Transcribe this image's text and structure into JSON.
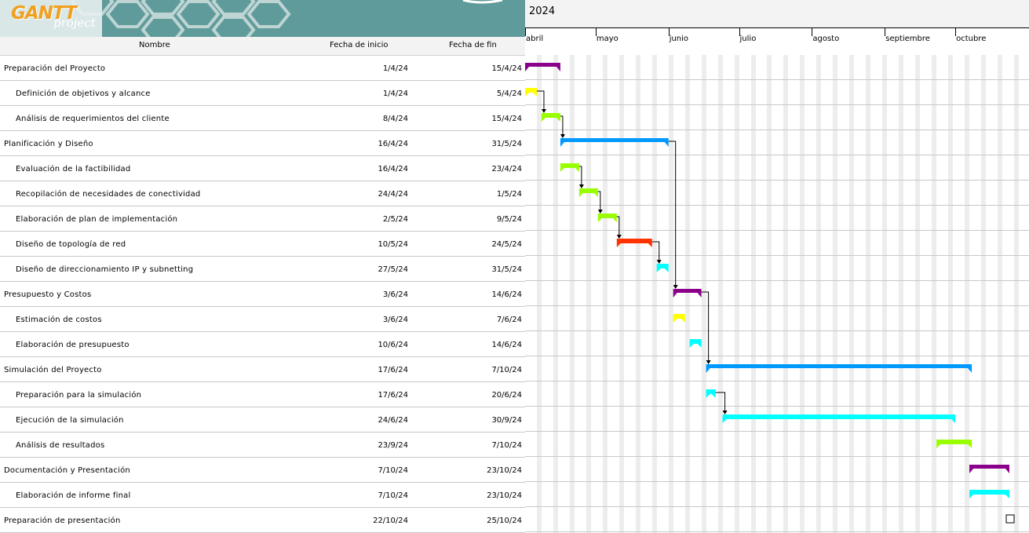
{
  "logo": {
    "brand": "GANTT",
    "sub": "project"
  },
  "columns": {
    "name": "Nombre",
    "start": "Fecha de inicio",
    "end": "Fecha de fin"
  },
  "timeline": {
    "year": "2024",
    "months": [
      "abril",
      "mayo",
      "junio",
      "julio",
      "agosto",
      "septiembre",
      "octubre"
    ]
  },
  "tasks": [
    {
      "name": "Preparación del Proyecto",
      "start": "1/4/24",
      "end": "15/4/24",
      "level": 0,
      "color": "#8b008b"
    },
    {
      "name": "Definición de objetivos y alcance",
      "start": "1/4/24",
      "end": "5/4/24",
      "level": 1,
      "color": "#ffff00"
    },
    {
      "name": "Análisis de requerimientos del cliente",
      "start": "8/4/24",
      "end": "15/4/24",
      "level": 1,
      "color": "#99ff00"
    },
    {
      "name": "Planificación y Diseño",
      "start": "16/4/24",
      "end": "31/5/24",
      "level": 0,
      "color": "#0099ff"
    },
    {
      "name": "Evaluación de la factibilidad",
      "start": "16/4/24",
      "end": "23/4/24",
      "level": 1,
      "color": "#99ff00"
    },
    {
      "name": "Recopilación de necesidades de conectividad",
      "start": "24/4/24",
      "end": "1/5/24",
      "level": 1,
      "color": "#99ff00"
    },
    {
      "name": "Elaboración de plan de implementación",
      "start": "2/5/24",
      "end": "9/5/24",
      "level": 1,
      "color": "#99ff00"
    },
    {
      "name": "Diseño de topología de red",
      "start": "10/5/24",
      "end": "24/5/24",
      "level": 1,
      "color": "#ff3300"
    },
    {
      "name": "Diseño de direccionamiento IP y subnetting",
      "start": "27/5/24",
      "end": "31/5/24",
      "level": 1,
      "color": "#00ffff"
    },
    {
      "name": "Presupuesto y Costos",
      "start": "3/6/24",
      "end": "14/6/24",
      "level": 0,
      "color": "#8b008b"
    },
    {
      "name": "Estimación de costos",
      "start": "3/6/24",
      "end": "7/6/24",
      "level": 1,
      "color": "#ffff00"
    },
    {
      "name": "Elaboración de presupuesto",
      "start": "10/6/24",
      "end": "14/6/24",
      "level": 1,
      "color": "#00ffff"
    },
    {
      "name": "Simulación del Proyecto",
      "start": "17/6/24",
      "end": "7/10/24",
      "level": 0,
      "color": "#0099ff"
    },
    {
      "name": "Preparación para la simulación",
      "start": "17/6/24",
      "end": "20/6/24",
      "level": 1,
      "color": "#00ffff"
    },
    {
      "name": "Ejecución de la simulación",
      "start": "24/6/24",
      "end": "30/9/24",
      "level": 1,
      "color": "#00ffff"
    },
    {
      "name": "Análisis de resultados",
      "start": "23/9/24",
      "end": "7/10/24",
      "level": 1,
      "color": "#99ff00"
    },
    {
      "name": "Documentación y Presentación",
      "start": "7/10/24",
      "end": "23/10/24",
      "level": 0,
      "color": "#8b008b"
    },
    {
      "name": "Elaboración de informe final",
      "start": "7/10/24",
      "end": "23/10/24",
      "level": 1,
      "color": "#00ffff"
    },
    {
      "name": "Preparación de presentación",
      "start": "22/10/24",
      "end": "25/10/24",
      "level": 0,
      "color": "milestone"
    }
  ],
  "dependencies": [
    [
      1,
      2
    ],
    [
      2,
      3
    ],
    [
      3,
      9
    ],
    [
      4,
      5
    ],
    [
      5,
      6
    ],
    [
      6,
      7
    ],
    [
      7,
      8
    ],
    [
      9,
      12
    ],
    [
      13,
      14
    ]
  ]
}
